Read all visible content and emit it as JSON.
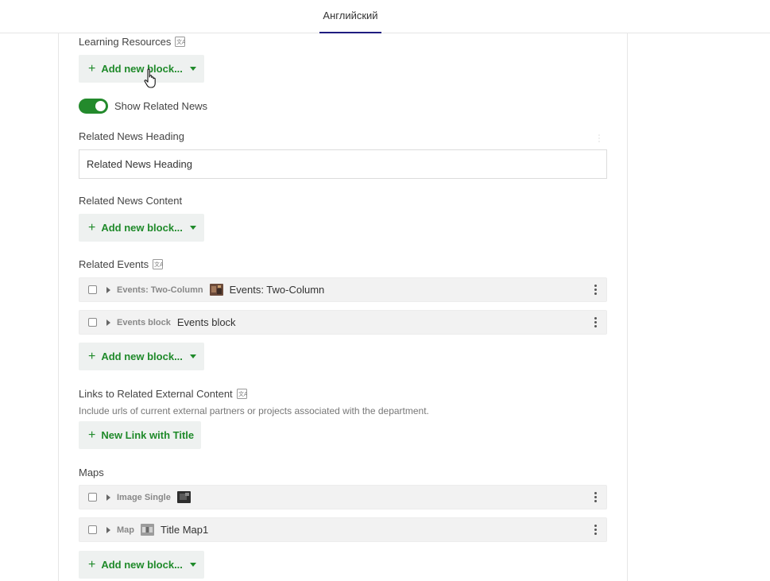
{
  "tabs": [
    {
      "label": "Английский",
      "active": true
    }
  ],
  "colors": {
    "accent_green": "#238a2c",
    "tab_underline": "#1f1c80"
  },
  "fields": {
    "learning_resources": {
      "label": "Learning Resources",
      "add_label": "Add new block..."
    },
    "show_related_news": {
      "label": "Show Related News",
      "on": true
    },
    "related_news_heading": {
      "label": "Related News Heading",
      "value": "Related News Heading"
    },
    "related_news_content": {
      "label": "Related News Content",
      "add_label": "Add new block..."
    },
    "related_events": {
      "label": "Related Events",
      "blocks": [
        {
          "type": "Events: Two-Column",
          "title": "Events: Two-Column",
          "thumb": "event-photo-icon"
        },
        {
          "type": "Events block",
          "title": "Events block"
        }
      ],
      "add_label": "Add new block..."
    },
    "links_external": {
      "label": "Links to Related External Content",
      "help": "Include urls of current external partners or projects associated with the department.",
      "add_label": "New Link with Title"
    },
    "maps": {
      "label": "Maps",
      "blocks": [
        {
          "type": "Image Single",
          "title": "",
          "thumb": "image-thumb-icon"
        },
        {
          "type": "Map",
          "title": "Title Map1",
          "thumb": "map-thumb-icon"
        }
      ],
      "add_label": "Add new block..."
    }
  }
}
